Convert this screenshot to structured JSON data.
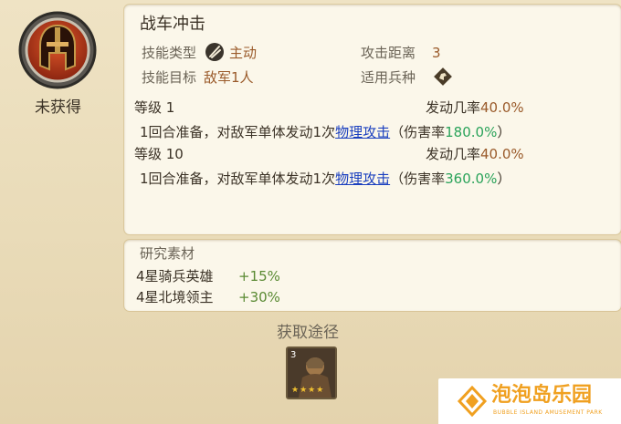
{
  "skill": {
    "name": "战车冲击",
    "status": "未获得",
    "type_label": "技能类型",
    "type_value": "主动",
    "range_label": "攻击距离",
    "range_value": "3",
    "target_label": "技能目标",
    "target_value": "敌军1人",
    "unit_label": "适用兵种"
  },
  "levels": [
    {
      "level_label": "等级 1",
      "rate_label": "发动几率",
      "rate_value": "40.0%",
      "desc_prefix": "1回合准备，对敌军单体发动1次",
      "desc_link": "物理攻击",
      "desc_mid": "（伤害率",
      "damage": "180.0%",
      "desc_suffix": "）"
    },
    {
      "level_label": "等级 10",
      "rate_label": "发动几率",
      "rate_value": "40.0%",
      "desc_prefix": "1回合准备，对敌军单体发动1次",
      "desc_link": "物理攻击",
      "desc_mid": "（伤害率",
      "damage": "360.0%",
      "desc_suffix": "）"
    }
  ],
  "research": {
    "title": "研究素材",
    "items": [
      {
        "name": "4星骑兵英雄",
        "bonus": "+15%"
      },
      {
        "name": "4星北境领主",
        "bonus": "+30%"
      }
    ]
  },
  "source": {
    "title": "获取途径",
    "item_badge": "3",
    "item_stars": 4
  },
  "watermark": {
    "brand": "泡泡岛乐园",
    "sub": "BUBBLE ISLAND AMUSEMENT PARK"
  },
  "colors": {
    "accent_brown": "#9a5a2a",
    "damage_green": "#2aa35a",
    "bonus_green": "#5a8a33",
    "link_blue": "#1a3fbf",
    "watermark_orange": "#f0a020"
  }
}
